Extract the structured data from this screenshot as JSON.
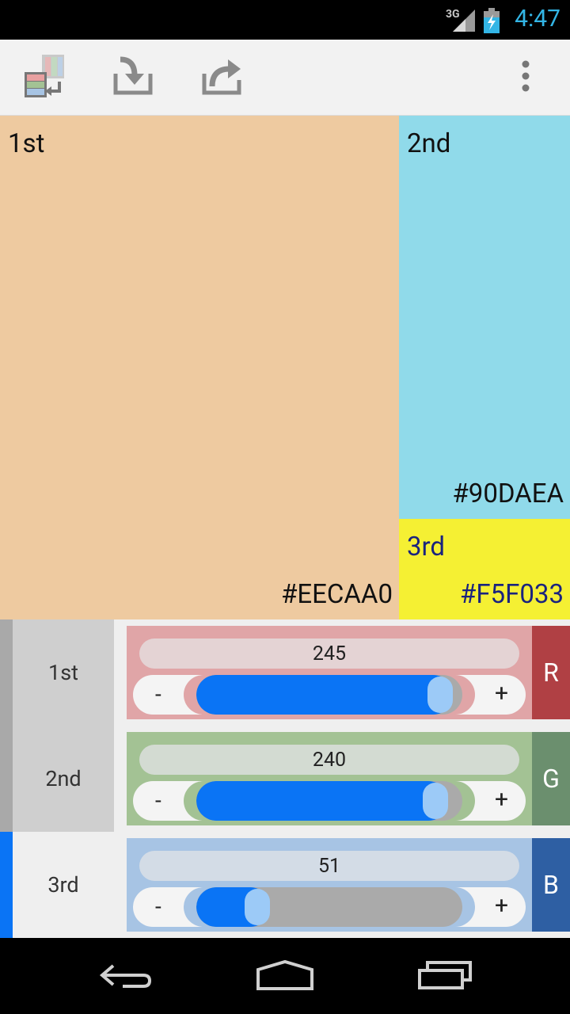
{
  "status": {
    "network": "3G",
    "time": "4:47"
  },
  "panels": [
    {
      "name": "1st",
      "hex": "#EECAA0",
      "color": "#EECAA0"
    },
    {
      "name": "2nd",
      "hex": "#90DAEA",
      "color": "#90DAEA"
    },
    {
      "name": "3rd",
      "hex": "#F5F033",
      "color": "#F5F033"
    }
  ],
  "selector": {
    "items": [
      "1st",
      "2nd",
      "3rd"
    ],
    "selected": "3rd"
  },
  "channels": [
    {
      "tag": "R",
      "value": "245",
      "fraction": 0.961,
      "bg": "#e0a5a7",
      "valbg": "#e4d3d4",
      "tagbg": "#b04044",
      "trackbg": "#e0a5a7"
    },
    {
      "tag": "G",
      "value": "240",
      "fraction": 0.941,
      "bg": "#a3c294",
      "valbg": "#d3dbd2",
      "tagbg": "#6b8f6e",
      "trackbg": "#a3c294"
    },
    {
      "tag": "B",
      "value": "51",
      "fraction": 0.2,
      "bg": "#a7c4e4",
      "valbg": "#d3dce6",
      "tagbg": "#2e5fa3",
      "trackbg": "#a7c4e4"
    }
  ],
  "controls": {
    "minus": "-",
    "plus": "+"
  },
  "icons": [
    "swap-colors-icon",
    "import-icon",
    "share-icon",
    "overflow-menu-icon",
    "back-icon",
    "home-icon",
    "recent-apps-icon"
  ]
}
